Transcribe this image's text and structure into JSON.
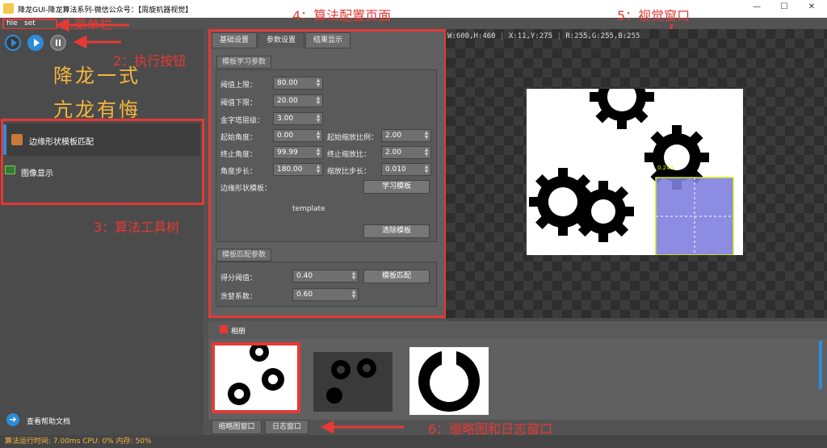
{
  "window": {
    "title": "降龙GUI-降龙算法系列-微信公众号：【周旋机器视觉】",
    "minimize": "—",
    "maximize": "☐",
    "close": "✕"
  },
  "menu": {
    "items": [
      "file",
      "set"
    ]
  },
  "annotations": {
    "a1": "1.菜单栏",
    "a2": "2：执行按钮",
    "a3": "3：算法工具树",
    "a4": "4：算法配置页面",
    "a5": "5：视觉窗口",
    "a6": "6：缩略图和日志窗口"
  },
  "motto": {
    "line1": "降龙一式",
    "line2": "亢龙有悔"
  },
  "tree": {
    "items": [
      {
        "label": "边缘形状模板匹配",
        "icon": "shape-match-icon"
      },
      {
        "label": "图像显示",
        "icon": "image-icon"
      }
    ]
  },
  "help": {
    "label": "查看帮助文档"
  },
  "tabs": [
    "基础设置",
    "参数设置",
    "结果显示"
  ],
  "learn": {
    "title": "模板学习参数",
    "threshold_high_label": "阈值上限：",
    "threshold_high": "80.00",
    "threshold_low_label": "阈值下限：",
    "threshold_low": "20.00",
    "pyramid_label": "金字塔层级：",
    "pyramid": "3.00",
    "angle_start_label": "起始角度：",
    "angle_start": "0.00",
    "angle_end_label": "终止角度：",
    "angle_end": "99.99",
    "angle_step_label": "角度步长：",
    "angle_step": "180.00",
    "scale_start_label": "起始缩放比例：",
    "scale_start": "2.00",
    "scale_end_label": "终止缩放比：",
    "scale_end": "2.00",
    "scale_step_label": "缩放比步长：",
    "scale_step": "0.010",
    "template_label": "边缘形状模板：",
    "learn_button": "学习模板",
    "template_text": "template",
    "clear_button": "清除模板"
  },
  "match": {
    "title": "模板匹配参数",
    "score_label": "得分阈值：",
    "score": "0.40",
    "greedy_label": "贪婪系数：",
    "greedy": "0.60",
    "match_button": "模板匹配"
  },
  "viewer": {
    "size": "W:600,H:460",
    "pos": "X:11,Y:275",
    "rgb": "R:255,G:255,B:255",
    "roi_label": "0.243"
  },
  "album": {
    "label": "相册"
  },
  "bottom_tabs": [
    "缩略图窗口",
    "日志窗口"
  ],
  "status": {
    "text": "算法运行时间:  7.00ms  CPU: 0%  内存: 50%"
  },
  "colors": {
    "accent": "#2d8cd8",
    "annotation": "#e53935",
    "motto": "#f6b73c",
    "roi": "#8080e0"
  }
}
